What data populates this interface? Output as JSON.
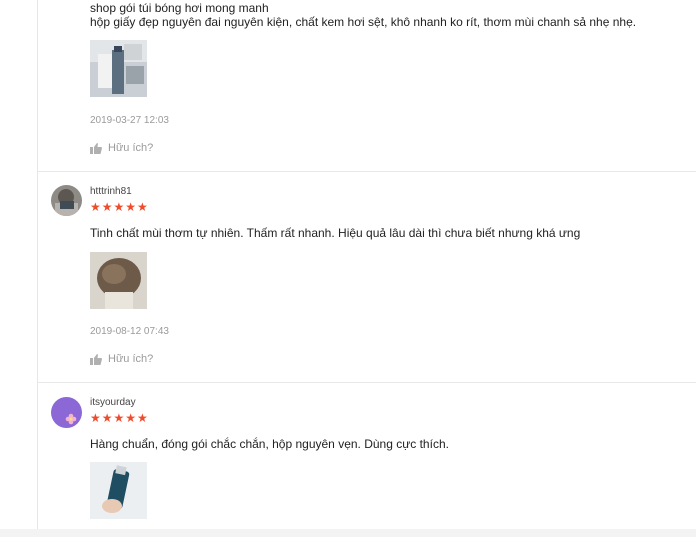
{
  "reviews": [
    {
      "username": "",
      "stars": "★★★★★",
      "lines": [
        "shop gói túi bóng hơi mong manh",
        "hộp giấy đẹp nguyên đai nguyên kiện, chất kem hơi sệt, khô nhanh ko rít, thơm mùi chanh sả nhẹ nhẹ."
      ],
      "time": "2019-03-27 12:03",
      "helpful": "Hữu ích?"
    },
    {
      "username": "htttrinh81",
      "stars": "★★★★★",
      "lines": [
        "Tinh chất mùi thơm tự nhiên. Thấm rất nhanh. Hiệu quả lâu dài thì chưa biết nhưng khá ưng"
      ],
      "time": "2019-08-12 07:43",
      "helpful": "Hữu ích?"
    },
    {
      "username": "itsyourday",
      "stars": "★★★★★",
      "lines": [
        "Hàng chuẩn, đóng gói chắc chắn, hộp nguyên vẹn. Dùng cực thích."
      ],
      "time": "",
      "helpful": ""
    }
  ],
  "colors": {
    "star": "#ee4d2d",
    "meta": "#9a9a9a",
    "divider": "#e8e8e8"
  },
  "icons": [
    "thumbs-up-icon",
    "avatar-photo",
    "avatar-flower"
  ]
}
